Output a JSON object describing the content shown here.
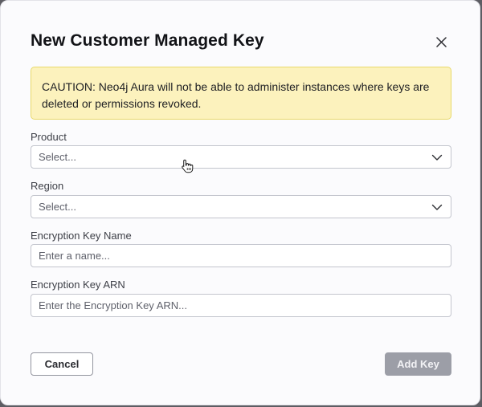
{
  "dialog": {
    "title": "New Customer Managed Key",
    "caution": "CAUTION: Neo4j Aura will not be able to administer instances where keys are deleted or permissions revoked."
  },
  "form": {
    "product": {
      "label": "Product",
      "placeholder": "Select..."
    },
    "region": {
      "label": "Region",
      "placeholder": "Select..."
    },
    "key_name": {
      "label": "Encryption Key Name",
      "placeholder": "Enter a name..."
    },
    "key_arn": {
      "label": "Encryption Key ARN",
      "placeholder": "Enter the Encryption Key ARN..."
    }
  },
  "actions": {
    "cancel_label": "Cancel",
    "add_label": "Add Key"
  },
  "icons": {
    "close": "close-icon",
    "dropdown": "chevron-down-icon",
    "pointer": "hand-pointer-icon"
  },
  "colors": {
    "caution_bg": "#fcf2bd",
    "caution_border": "#e8d96a",
    "primary_disabled": "#9c9ea7"
  }
}
